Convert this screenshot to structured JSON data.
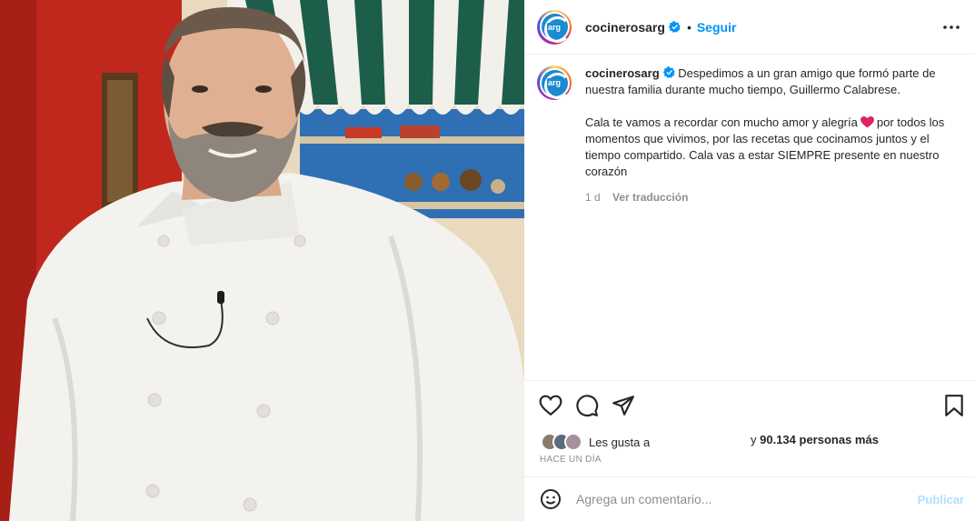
{
  "post": {
    "username": "cocinerosarg",
    "follow_label": "Seguir",
    "avatar_text": "arg",
    "caption": {
      "line1": "Despedimos a un gran amigo que formó parte de nuestra familia durante mucho tiempo, Guillermo Calabrese.",
      "line2a": "Cala te vamos a recordar con mucho amor y alegría",
      "line2b": "por todos los momentos que vivimos, por las recetas que cocinamos juntos y el tiempo compartido. Cala vas a estar SIEMPRE presente en nuestro corazón"
    },
    "time_ago": "1 d",
    "translate_label": "Ver traducción"
  },
  "likes": {
    "prefix": "Les gusta a",
    "count_prefix": "y",
    "count": "90.134 personas más"
  },
  "posted_ago": "HACE UN DÍA",
  "comment": {
    "placeholder": "Agrega un comentario...",
    "publish_label": "Publicar"
  },
  "icons": [
    "verified-badge-icon",
    "more-options-icon",
    "heart-icon",
    "comment-icon",
    "share-icon",
    "bookmark-icon",
    "emoji-icon"
  ],
  "colors": {
    "accent": "#0095f6",
    "publish_disabled": "#b2dffc",
    "muted": "#8e8e8e"
  }
}
